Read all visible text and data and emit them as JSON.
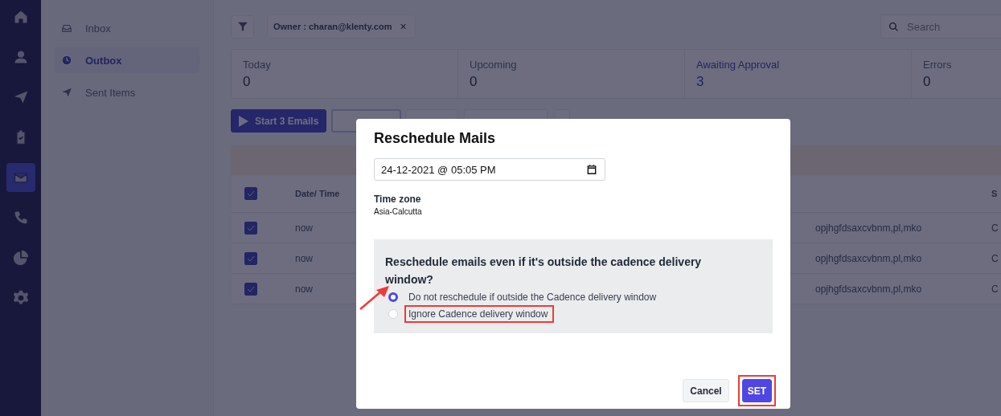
{
  "nav_rail": [
    {
      "kind": "home",
      "selected": false
    },
    {
      "kind": "user",
      "selected": false
    },
    {
      "kind": "send",
      "selected": false
    },
    {
      "kind": "clipboard",
      "selected": false
    },
    {
      "kind": "mail",
      "selected": true
    },
    {
      "kind": "phone",
      "selected": false
    },
    {
      "kind": "pie",
      "selected": false
    },
    {
      "kind": "gear",
      "selected": false
    }
  ],
  "sidebar": {
    "items": [
      {
        "kind": "inbox",
        "label": "Inbox",
        "selected": false
      },
      {
        "kind": "clock",
        "label": "Outbox",
        "selected": true
      },
      {
        "kind": "send",
        "label": "Sent Items",
        "selected": false
      }
    ]
  },
  "filter_chip": {
    "label": "Owner : charan@klenty.com",
    "remove": "×"
  },
  "search": {
    "placeholder": "Search"
  },
  "stats": [
    {
      "label": "Today",
      "value": "0",
      "selected": false
    },
    {
      "label": "Upcoming",
      "value": "0",
      "selected": false
    },
    {
      "label": "Awaiting Approval",
      "value": "3",
      "selected": true
    },
    {
      "label": "Errors",
      "value": "0",
      "selected": false
    }
  ],
  "actions": [
    {
      "kind": "primary",
      "label": "Start 3 Emails"
    },
    {
      "kind": "focused"
    },
    {
      "kind": "plain"
    },
    {
      "kind": "wide"
    },
    {
      "kind": "more"
    }
  ],
  "table": {
    "header_checked": true,
    "columns": [
      "Date/ Time",
      "S"
    ],
    "rows": [
      {
        "checked": true,
        "date": "now",
        "column_3": "opjhgfdsaxcvbnm,pl,mko",
        "column_4": "C"
      },
      {
        "checked": true,
        "date": "now",
        "column_3": "opjhgfdsaxcvbnm,pl,mko",
        "column_4": "C"
      },
      {
        "checked": true,
        "date": "now",
        "column_3": "opjhgfdsaxcvbnm,pl,mko",
        "column_4": "C"
      }
    ]
  },
  "modal": {
    "title": "Reschedule Mails",
    "date_value": "24-12-2021 @ 05:05 PM",
    "timezone_label": "Time zone",
    "timezone": "Asia-Calcutta",
    "question": "Reschedule emails even if it's outside the cadence delivery window?",
    "options": [
      {
        "label": "Do not reschedule if outside the Cadence delivery window",
        "selected": true,
        "highlighted": false
      },
      {
        "label": "Ignore Cadence delivery window",
        "selected": false,
        "highlighted": true
      }
    ],
    "buttons": [
      {
        "kind": "cancel",
        "label": "Cancel",
        "highlighted": false
      },
      {
        "kind": "primary",
        "label": "SET",
        "highlighted": true
      }
    ]
  }
}
